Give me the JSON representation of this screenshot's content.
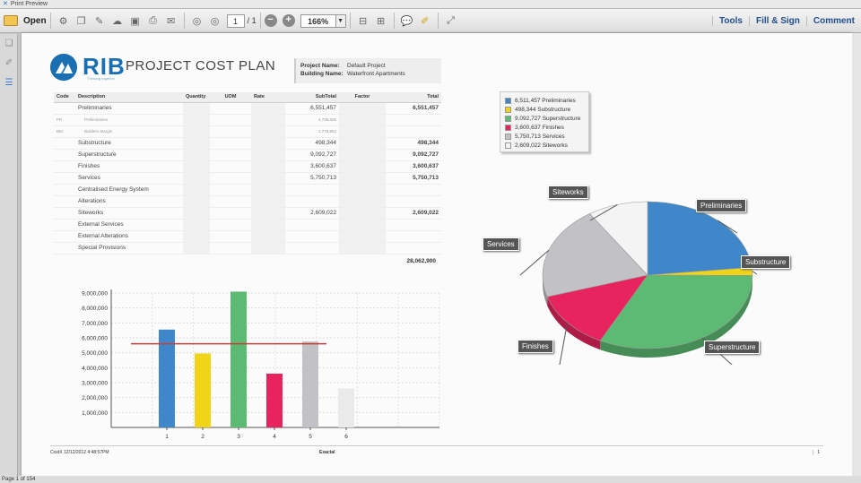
{
  "window": {
    "title": "Print Preview"
  },
  "toolbar": {
    "open_label": "Open",
    "page_current": "1",
    "page_total": "/ 1",
    "zoom": "166%"
  },
  "right_links": {
    "tools": "Tools",
    "fill_sign": "Fill & Sign",
    "comment": "Comment"
  },
  "status": {
    "text": "Page 1 of 154"
  },
  "doc": {
    "logo": "RIB",
    "logo_tag": "Thinking together",
    "title": "PROJECT COST PLAN",
    "project_name_label": "Project Name:",
    "project_name": "Default Project",
    "building_name_label": "Building Name:",
    "building_name": "Waterfront Apartments",
    "grand_total": "28,062,900",
    "footer_left": "CostX 12/12/2012 4:48:57PM",
    "footer_mid": "Exactal",
    "footer_page": "1"
  },
  "table": {
    "headers": [
      "Code",
      "Description",
      "Quantity",
      "UOM",
      "Rate",
      "SubTotal",
      "Factor",
      "Total"
    ],
    "rows": [
      {
        "code": "",
        "desc": "Preliminaries",
        "sub": "6,551,457",
        "total": "6,551,457",
        "sm": false
      },
      {
        "code": "PR",
        "desc": "Preliminaries",
        "sub": "4,735,605",
        "total": "",
        "sm": true
      },
      {
        "code": "BM",
        "desc": "Builders Margin",
        "sub": "1,775,852",
        "total": "",
        "sm": true
      },
      {
        "code": "",
        "desc": "Substructure",
        "sub": "498,344",
        "total": "498,344",
        "sm": false
      },
      {
        "code": "",
        "desc": "Superstructure",
        "sub": "9,092,727",
        "total": "9,092,727",
        "sm": false
      },
      {
        "code": "",
        "desc": "Finishes",
        "sub": "3,600,637",
        "total": "3,600,637",
        "sm": false
      },
      {
        "code": "",
        "desc": "Services",
        "sub": "5,750,713",
        "total": "5,750,713",
        "sm": false
      },
      {
        "code": "",
        "desc": "Centralised Energy System",
        "sub": "",
        "total": "",
        "sm": false
      },
      {
        "code": "",
        "desc": "Alterations",
        "sub": "",
        "total": "",
        "sm": false
      },
      {
        "code": "",
        "desc": "Siteworks",
        "sub": "2,609,022",
        "total": "2,609,022",
        "sm": false
      },
      {
        "code": "",
        "desc": "External Services",
        "sub": "",
        "total": "",
        "sm": false
      },
      {
        "code": "",
        "desc": "External Alterations",
        "sub": "",
        "total": "",
        "sm": false
      },
      {
        "code": "",
        "desc": "Special Provisions",
        "sub": "",
        "total": "",
        "sm": false
      }
    ]
  },
  "legend": [
    {
      "label": "6,511,457 Preliminaries",
      "color": "#3f87c9"
    },
    {
      "label": "498,344 Substructure",
      "color": "#f0d418"
    },
    {
      "label": "9,092,727 Superstructure",
      "color": "#5cba72"
    },
    {
      "label": "3,600,637 Finishes",
      "color": "#e8245e"
    },
    {
      "label": "5,750,713 Services",
      "color": "#c2c2c6"
    },
    {
      "label": "2,609,022 Siteworks",
      "color": "#f4f4f4"
    }
  ],
  "pie_labels": [
    "Preliminaries",
    "Substructure",
    "Superstructure",
    "Finishes",
    "Services",
    "Siteworks"
  ],
  "chart_data": [
    {
      "type": "bar",
      "categories": [
        "1",
        "2",
        "3",
        "4",
        "5",
        "6"
      ],
      "values": [
        6551457,
        4950000,
        9092727,
        3600637,
        5750713,
        2609022
      ],
      "colors": [
        "#3f87c9",
        "#f0d418",
        "#5cba72",
        "#e8245e",
        "#c2c2c6",
        "#eaeaea"
      ],
      "ylim": [
        0,
        9000000
      ],
      "yticks": [
        "9,000,000",
        "8,000,000",
        "7,000,000",
        "6,000,000",
        "5,000,000",
        "4,000,000",
        "3,000,000",
        "2,000,000",
        "1,000,000"
      ],
      "avg_line": 5600000,
      "avg_color": "#c83c3c",
      "grid": true
    },
    {
      "type": "pie",
      "categories": [
        "Preliminaries",
        "Substructure",
        "Superstructure",
        "Finishes",
        "Services",
        "Siteworks"
      ],
      "values": [
        6551457,
        498344,
        9092727,
        3600637,
        5750713,
        2609022
      ],
      "colors": [
        "#3f87c9",
        "#f0d418",
        "#5cba72",
        "#e8245e",
        "#c2c2c6",
        "#f4f4f4"
      ]
    }
  ]
}
